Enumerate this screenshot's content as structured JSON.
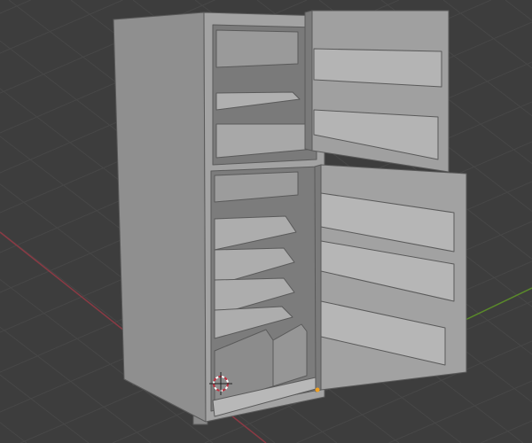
{
  "viewport": {
    "background_color": "#3d3d3d",
    "grid_color": "#474747",
    "x_axis_color": "#8a3a44",
    "y_axis_color": "#5a8a2a",
    "model_color": "#9a9a9a",
    "model_shadow_color": "#6e6e6e",
    "cursor_icon": "3d-cursor-icon",
    "origin_icon": "object-origin-icon"
  }
}
